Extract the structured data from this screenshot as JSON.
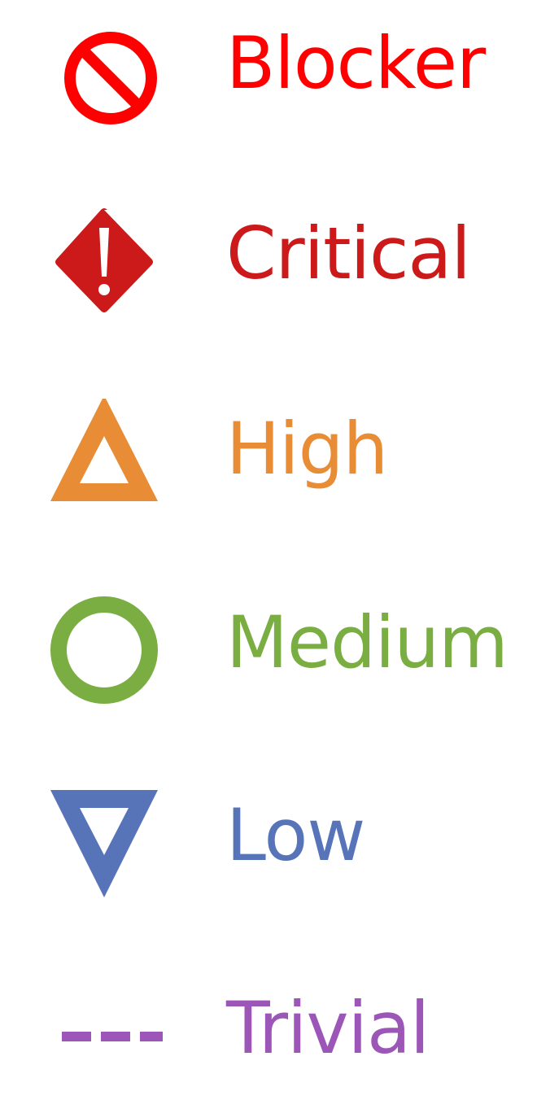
{
  "legend": {
    "items": [
      {
        "key": "blocker",
        "label": "Blocker",
        "icon": "prohibited-icon",
        "color": "#ff0000"
      },
      {
        "key": "critical",
        "label": "Critical",
        "icon": "diamond-exclamation-icon",
        "color": "#cc1a1a"
      },
      {
        "key": "high",
        "label": "High",
        "icon": "triangle-up-icon",
        "color": "#e88c35"
      },
      {
        "key": "medium",
        "label": "Medium",
        "icon": "circle-icon",
        "color": "#7aad42"
      },
      {
        "key": "low",
        "label": "Low",
        "icon": "triangle-down-icon",
        "color": "#5874b9"
      },
      {
        "key": "trivial",
        "label": "Trivial",
        "icon": "dashed-line-icon",
        "color": "#9c56b7"
      }
    ]
  }
}
